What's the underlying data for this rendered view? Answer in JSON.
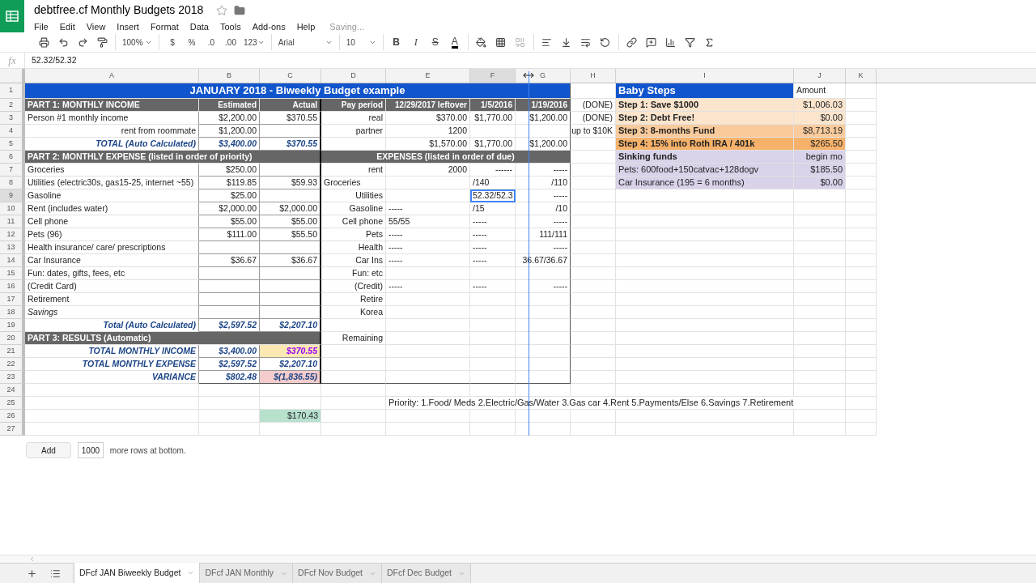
{
  "doc": {
    "title": "debtfree.cf Monthly Budgets 2018",
    "status": "Saving..."
  },
  "menu": [
    "File",
    "Edit",
    "View",
    "Insert",
    "Format",
    "Data",
    "Tools",
    "Add-ons",
    "Help"
  ],
  "toolbar": {
    "zoom": "100%",
    "currency": "$",
    "percent": "%",
    "dec_less": ".0",
    "dec_more": ".00",
    "format": "123",
    "font": "Arial",
    "size": "10",
    "bold": "B",
    "italic": "I",
    "strike": "S",
    "text_color_label": "A"
  },
  "formula_bar": {
    "label": "fx",
    "value": "52.32/52.32"
  },
  "columns": [
    {
      "label": "A",
      "selected": false
    },
    {
      "label": "B",
      "selected": false
    },
    {
      "label": "C",
      "selected": false
    },
    {
      "label": "D",
      "selected": false
    },
    {
      "label": "E",
      "selected": false
    },
    {
      "label": "F",
      "selected": true
    },
    {
      "label": "G",
      "selected": false
    },
    {
      "label": "H",
      "selected": false
    },
    {
      "label": "I",
      "selected": false
    },
    {
      "label": "J",
      "selected": false
    },
    {
      "label": "K",
      "selected": false
    }
  ],
  "rows": [
    {
      "num": "1",
      "selected": false,
      "cells": [
        {
          "kind": "title",
          "text": "JANUARY 2018 - Biweekly Budget example",
          "selected": false
        },
        null,
        {
          "kind": "blue-head",
          "text": "Baby Steps",
          "selected": false
        },
        {
          "kind": "text",
          "text": "Amount",
          "selected": false
        },
        null
      ]
    },
    {
      "num": "2",
      "selected": false,
      "cells": [
        {
          "kind": "head-left",
          "text": "PART 1: MONTHLY INCOME",
          "selected": false
        },
        {
          "kind": "head",
          "text": "Estimated",
          "selected": false
        },
        {
          "kind": "head",
          "text": "Actual",
          "selected": false
        },
        {
          "kind": "head",
          "text": "Pay period",
          "selected": false
        },
        {
          "kind": "head",
          "text": "12/29/2017 leftover",
          "selected": false
        },
        {
          "kind": "head",
          "text": "1/5/2016",
          "selected": false
        },
        {
          "kind": "head",
          "text": "1/19/2016",
          "selected": false
        },
        {
          "kind": "text-right",
          "text": "(DONE)",
          "selected": false
        },
        {
          "kind": "tag",
          "text": "Step 1: Save $1000",
          "color": "#fce5cd",
          "selected": false
        },
        {
          "kind": "tag-num",
          "text": "$1,006.03",
          "color": "#fce5cd",
          "selected": false
        },
        null
      ]
    },
    {
      "num": "3",
      "selected": false,
      "cells": [
        {
          "kind": "text",
          "text": "Person #1 monthly income",
          "selected": false
        },
        {
          "kind": "num",
          "text": "$2,200.00",
          "selected": false
        },
        {
          "kind": "num",
          "text": "$370.55",
          "selected": false
        },
        {
          "kind": "text-right",
          "text": "real",
          "selected": false
        },
        {
          "kind": "num",
          "text": "$370.00",
          "selected": false
        },
        {
          "kind": "num",
          "text": "$1,770.00",
          "selected": false
        },
        {
          "kind": "num",
          "text": "$1,200.00",
          "selected": false
        },
        {
          "kind": "text-right",
          "text": "(DONE)",
          "selected": false
        },
        {
          "kind": "tag",
          "text": "Step 2: Debt Free!",
          "color": "#fce5cd",
          "selected": false
        },
        {
          "kind": "tag-num",
          "text": "$0.00",
          "color": "#fce5cd",
          "selected": false
        },
        null
      ]
    },
    {
      "num": "4",
      "selected": false,
      "cells": [
        {
          "kind": "text-right",
          "text": "rent from roommate",
          "selected": false
        },
        {
          "kind": "num",
          "text": "$1,200.00",
          "selected": false
        },
        null,
        {
          "kind": "text-right",
          "text": "partner",
          "selected": false
        },
        {
          "kind": "num",
          "text": "1200",
          "selected": false
        },
        null,
        null,
        {
          "kind": "text-right",
          "text": "up to $10K",
          "selected": false
        },
        {
          "kind": "tag",
          "text": "Step 3: 8-months Fund",
          "color": "#f9cb9c",
          "selected": false
        },
        {
          "kind": "tag-num",
          "text": "$8,713.19",
          "color": "#f9cb9c",
          "selected": false
        },
        null
      ]
    },
    {
      "num": "5",
      "selected": false,
      "cells": [
        {
          "kind": "total",
          "text": "TOTAL (Auto Calculated)",
          "selected": false
        },
        {
          "kind": "total",
          "text": "$3,400.00",
          "selected": false
        },
        {
          "kind": "total",
          "text": "$370.55",
          "selected": false
        },
        null,
        {
          "kind": "num",
          "text": "$1,570.00",
          "selected": false
        },
        {
          "kind": "num",
          "text": "$1,770.00",
          "selected": false
        },
        {
          "kind": "num",
          "text": "$1,200.00",
          "selected": false
        },
        null,
        {
          "kind": "tag",
          "text": "Step 4: 15% into Roth IRA / 401k",
          "color": "#f6b26b",
          "selected": false
        },
        {
          "kind": "tag-num",
          "text": "$265.50",
          "color": "#f6b26b",
          "selected": false
        },
        null
      ]
    },
    {
      "num": "6",
      "selected": false,
      "cells": [
        {
          "kind": "section",
          "text": "PART 2: MONTHLY EXPENSE (listed in order of priority)",
          "selected": false
        },
        {
          "kind": "section-center",
          "text": "EXPENSES (listed in order of due)",
          "selected": false
        },
        null,
        {
          "kind": "tag",
          "text": "Sinking funds",
          "color": "#d9d2e9",
          "selected": false
        },
        {
          "kind": "tag-num",
          "text": "begin mo",
          "color": "#d9d2e9",
          "selected": false
        },
        null
      ]
    },
    {
      "num": "7",
      "selected": false,
      "cells": [
        {
          "kind": "text",
          "text": "Groceries",
          "selected": false
        },
        {
          "kind": "num",
          "text": "$250.00",
          "selected": false
        },
        null,
        {
          "kind": "text-right",
          "text": "rent",
          "selected": false
        },
        {
          "kind": "num",
          "text": "2000",
          "selected": false
        },
        {
          "kind": "text-right",
          "text": "------",
          "selected": false
        },
        {
          "kind": "text-right",
          "text": "-----",
          "selected": false
        },
        null,
        {
          "kind": "tag-note",
          "text": "Pets: 600food+150catvac+128dogv",
          "color": "#d9d2e9",
          "selected": false
        },
        {
          "kind": "tag-num",
          "text": "$185.50",
          "color": "#d9d2e9",
          "selected": false
        },
        null
      ]
    },
    {
      "num": "8",
      "selected": false,
      "cells": [
        {
          "kind": "text",
          "text": "Utilities (electric30s, gas15-25, internet ~55)",
          "selected": false
        },
        {
          "kind": "num",
          "text": "$119.85",
          "selected": false
        },
        {
          "kind": "num",
          "text": "$59.93",
          "selected": false
        },
        {
          "kind": "text",
          "text": "Groceries",
          "selected": false
        },
        null,
        {
          "kind": "text",
          "text": "/140",
          "selected": false
        },
        {
          "kind": "text-right",
          "text": "/110",
          "selected": false
        },
        null,
        {
          "kind": "tag-note",
          "text": "Car Insurance (195 = 6 months)",
          "color": "#d9d2e9",
          "selected": false
        },
        {
          "kind": "tag-num",
          "text": "$0.00",
          "color": "#d9d2e9",
          "selected": false
        },
        null
      ]
    },
    {
      "num": "9",
      "selected": true,
      "cells": [
        {
          "kind": "text",
          "text": "Gasoline",
          "selected": false
        },
        {
          "kind": "num",
          "text": "$25.00",
          "selected": false
        },
        null,
        {
          "kind": "text-right",
          "text": "Utilities",
          "selected": false
        },
        null,
        {
          "kind": "text",
          "text": "52.32/52.3",
          "selected": true
        },
        {
          "kind": "text-right",
          "text": "-----",
          "selected": false
        },
        null,
        null,
        null,
        null
      ]
    },
    {
      "num": "10",
      "selected": false,
      "cells": [
        {
          "kind": "text",
          "text": "Rent (includes water)",
          "selected": false
        },
        {
          "kind": "num",
          "text": "$2,000.00",
          "selected": false
        },
        {
          "kind": "num",
          "text": "$2,000.00",
          "selected": false
        },
        {
          "kind": "text-right",
          "text": "Gasoline",
          "selected": false
        },
        {
          "kind": "text",
          "text": "-----",
          "selected": false
        },
        {
          "kind": "text",
          "text": "/15",
          "selected": false
        },
        {
          "kind": "text-right",
          "text": "/10",
          "selected": false
        },
        null,
        null,
        null,
        null
      ]
    },
    {
      "num": "11",
      "selected": false,
      "cells": [
        {
          "kind": "text",
          "text": "Cell phone",
          "selected": false
        },
        {
          "kind": "num",
          "text": "$55.00",
          "selected": false
        },
        {
          "kind": "num",
          "text": "$55.00",
          "selected": false
        },
        {
          "kind": "text-right",
          "text": "Cell phone",
          "selected": false
        },
        {
          "kind": "text",
          "text": "55/55",
          "selected": false
        },
        {
          "kind": "text",
          "text": "-----",
          "selected": false
        },
        {
          "kind": "text-right",
          "text": "-----",
          "selected": false
        },
        null,
        null,
        null,
        null
      ]
    },
    {
      "num": "12",
      "selected": false,
      "cells": [
        {
          "kind": "text",
          "text": "Pets (96)",
          "selected": false
        },
        {
          "kind": "num",
          "text": "$111.00",
          "selected": false
        },
        {
          "kind": "num",
          "text": "$55.50",
          "selected": false
        },
        {
          "kind": "text-right",
          "text": "Pets",
          "selected": false
        },
        {
          "kind": "text",
          "text": "-----",
          "selected": false
        },
        {
          "kind": "text",
          "text": "-----",
          "selected": false
        },
        {
          "kind": "text-right",
          "text": "111/111",
          "selected": false
        },
        null,
        null,
        null,
        null
      ]
    },
    {
      "num": "13",
      "selected": false,
      "cells": [
        {
          "kind": "text",
          "text": "Health insurance/ care/ prescriptions",
          "selected": false
        },
        null,
        null,
        {
          "kind": "text-right",
          "text": "Health",
          "selected": false
        },
        {
          "kind": "text",
          "text": "-----",
          "selected": false
        },
        {
          "kind": "text",
          "text": "-----",
          "selected": false
        },
        {
          "kind": "text-right",
          "text": "-----",
          "selected": false
        },
        null,
        null,
        null,
        null
      ]
    },
    {
      "num": "14",
      "selected": false,
      "cells": [
        {
          "kind": "text",
          "text": "Car Insurance",
          "selected": false
        },
        {
          "kind": "num",
          "text": "$36.67",
          "selected": false
        },
        {
          "kind": "num",
          "text": "$36.67",
          "selected": false
        },
        {
          "kind": "text-right",
          "text": "Car Ins",
          "selected": false
        },
        {
          "kind": "text",
          "text": "-----",
          "selected": false
        },
        {
          "kind": "text",
          "text": "-----",
          "selected": false
        },
        {
          "kind": "text-right",
          "text": "36.67/36.67",
          "selected": false
        },
        null,
        null,
        null,
        null
      ]
    },
    {
      "num": "15",
      "selected": false,
      "cells": [
        {
          "kind": "text",
          "text": "Fun: dates, gifts, fees, etc",
          "selected": false
        },
        null,
        null,
        {
          "kind": "text-right",
          "text": "Fun: etc",
          "selected": false
        },
        null,
        null,
        null,
        null,
        null,
        null,
        null
      ]
    },
    {
      "num": "16",
      "selected": false,
      "cells": [
        {
          "kind": "text",
          "text": "(Credit Card)",
          "selected": false
        },
        null,
        null,
        {
          "kind": "text-right",
          "text": "(Credit)",
          "selected": false
        },
        {
          "kind": "text",
          "text": "-----",
          "selected": false
        },
        {
          "kind": "text",
          "text": "-----",
          "selected": false
        },
        {
          "kind": "text-right",
          "text": "-----",
          "selected": false
        },
        null,
        null,
        null,
        null
      ]
    },
    {
      "num": "17",
      "selected": false,
      "cells": [
        {
          "kind": "text",
          "text": "Retirement",
          "selected": false
        },
        null,
        null,
        {
          "kind": "text-right",
          "text": "Retire",
          "selected": false
        },
        null,
        null,
        null,
        null,
        null,
        null,
        null
      ]
    },
    {
      "num": "18",
      "selected": false,
      "cells": [
        {
          "kind": "italic",
          "text": "Savings",
          "selected": false
        },
        null,
        null,
        {
          "kind": "text-right",
          "text": "Korea",
          "selected": false
        },
        null,
        null,
        null,
        null,
        null,
        null,
        null
      ]
    },
    {
      "num": "19",
      "selected": false,
      "cells": [
        {
          "kind": "total",
          "text": "Total (Auto Calculated)",
          "selected": false
        },
        {
          "kind": "total",
          "text": "$2,597.52",
          "selected": false
        },
        {
          "kind": "total",
          "text": "$2,207.10",
          "selected": false
        },
        null,
        null,
        null,
        null,
        null,
        null,
        null,
        null
      ]
    },
    {
      "num": "20",
      "selected": false,
      "cells": [
        {
          "kind": "section",
          "text": "PART 3: RESULTS (Automatic)",
          "selected": false
        },
        {
          "kind": "text-right",
          "text": "Remaining",
          "selected": false
        },
        null,
        null,
        null,
        null,
        null,
        null,
        null
      ]
    },
    {
      "num": "21",
      "selected": false,
      "cells": [
        {
          "kind": "total",
          "text": "TOTAL MONTHLY INCOME",
          "selected": false
        },
        {
          "kind": "total",
          "text": "$3,400.00",
          "selected": false
        },
        {
          "kind": "hl-income",
          "text": "$370.55",
          "selected": false
        },
        null,
        null,
        null,
        null,
        null,
        null,
        null,
        null
      ]
    },
    {
      "num": "22",
      "selected": false,
      "cells": [
        {
          "kind": "total",
          "text": "TOTAL MONTHLY EXPENSE",
          "selected": false
        },
        {
          "kind": "total",
          "text": "$2,597.52",
          "selected": false
        },
        {
          "kind": "total",
          "text": "$2,207.10",
          "selected": false
        },
        null,
        null,
        null,
        null,
        null,
        null,
        null,
        null
      ]
    },
    {
      "num": "23",
      "selected": false,
      "cells": [
        {
          "kind": "total",
          "text": "VARIANCE",
          "selected": false
        },
        {
          "kind": "total",
          "text": "$802.48",
          "selected": false
        },
        {
          "kind": "hl-variance",
          "text": "$(1,836.55)",
          "selected": false
        },
        null,
        null,
        null,
        null,
        null,
        null,
        null,
        null
      ]
    },
    {
      "num": "24",
      "selected": false,
      "cells": [
        null,
        null,
        null,
        null,
        null,
        null,
        null,
        null,
        null,
        null,
        null
      ]
    },
    {
      "num": "25",
      "selected": false,
      "cells": [
        null,
        null,
        null,
        null,
        {
          "kind": "note",
          "text": "Priority: 1.Food/ Meds 2.Electric/Gas/Water 3.Gas car 4.Rent 5.Payments/Else 6.Savings 7.Retirement",
          "selected": false
        },
        null
      ]
    },
    {
      "num": "26",
      "selected": false,
      "cells": [
        null,
        null,
        {
          "kind": "result",
          "text": "$170.43",
          "selected": false
        },
        null,
        null,
        null,
        null,
        null,
        null,
        null,
        null
      ]
    },
    {
      "num": "27",
      "selected": false,
      "cells": [
        null,
        null,
        null,
        null,
        null,
        null,
        null,
        null,
        null,
        null,
        null
      ]
    }
  ],
  "add_rows": {
    "button": "Add",
    "count": "1000",
    "suffix": "more rows at bottom."
  },
  "sheet_tabs": [
    {
      "label": "DFcf JAN Biweekly Budget",
      "selected": true
    },
    {
      "label": "DFcf JAN Monthly",
      "selected": false
    },
    {
      "label": "DFcf Nov Budget",
      "selected": false
    },
    {
      "label": "DFcf Dec Budget",
      "selected": false
    }
  ]
}
